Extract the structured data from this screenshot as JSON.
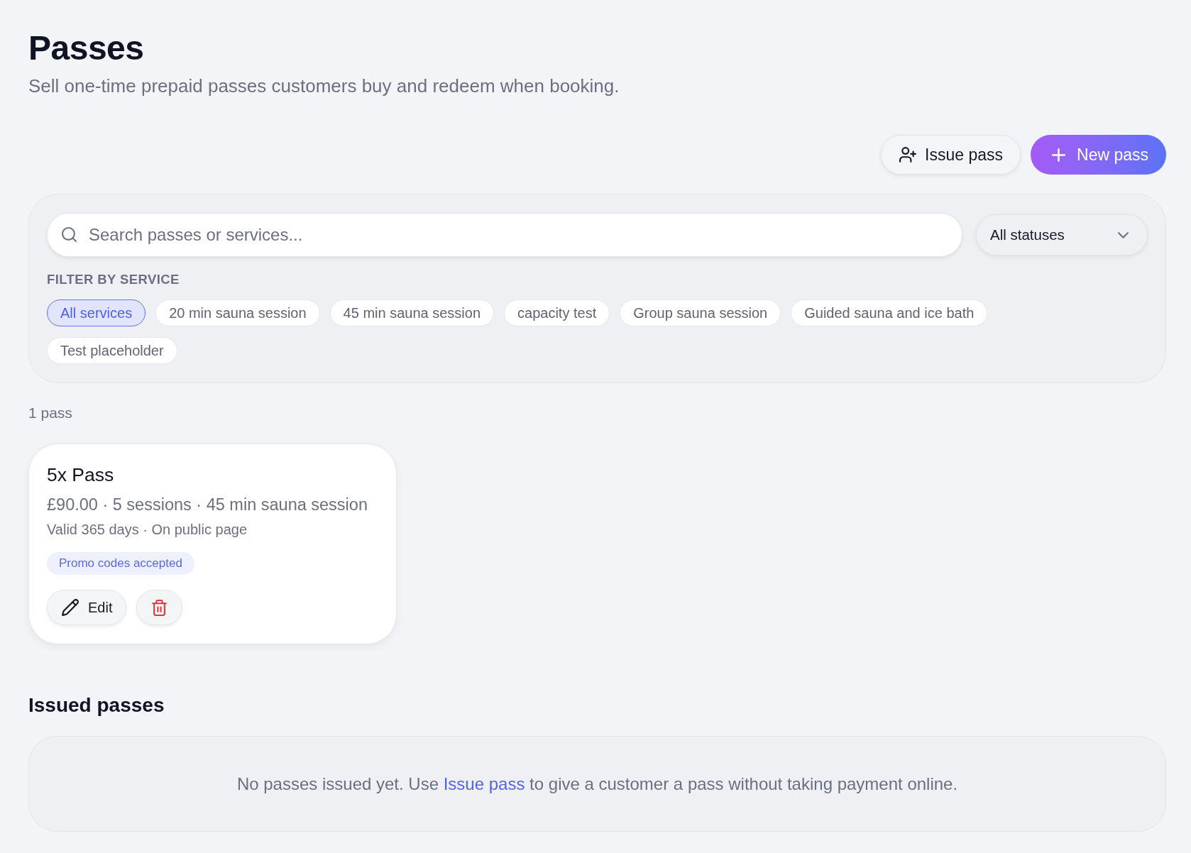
{
  "header": {
    "title": "Passes",
    "subtitle": "Sell one-time prepaid passes customers buy and redeem when booking."
  },
  "toolbar": {
    "buttons": [
      {
        "kind": "issue",
        "label": "Issue pass"
      },
      {
        "kind": "new",
        "label": "New pass"
      }
    ]
  },
  "filters": {
    "search": {
      "placeholder": "Search passes or services..."
    },
    "status_select": {
      "value": "All statuses"
    },
    "service_filter": {
      "label": "FILTER BY SERVICE",
      "chips": [
        {
          "label": "All services",
          "selected": true
        },
        {
          "label": "20 min sauna session",
          "selected": false
        },
        {
          "label": "45 min sauna session",
          "selected": false
        },
        {
          "label": "capacity test",
          "selected": false
        },
        {
          "label": "Group sauna session",
          "selected": false
        },
        {
          "label": "Guided sauna and ice bath",
          "selected": false
        },
        {
          "label": "Test placeholder",
          "selected": false
        }
      ]
    }
  },
  "pass_count": "1 pass",
  "passes": [
    {
      "name": "5x Pass",
      "summary": "£90.00 · 5 sessions · 45 min sauna session",
      "details": "Valid 365 days · On public page",
      "badges": [
        "Promo codes accepted"
      ],
      "actions": [
        {
          "kind": "edit",
          "label": "Edit"
        },
        {
          "kind": "delete"
        }
      ]
    }
  ],
  "issued_passes": {
    "heading": "Issued passes",
    "empty_state": {
      "text_before": "No passes issued yet. Use",
      "link": "Issue pass",
      "text_after": "to give a customer a pass without taking payment online."
    }
  }
}
